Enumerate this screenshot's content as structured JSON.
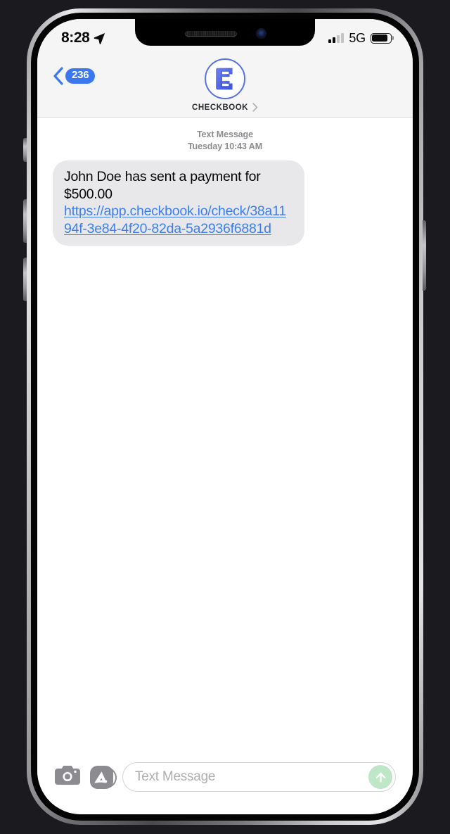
{
  "status_bar": {
    "time": "8:28",
    "location_icon": "location-arrow-icon",
    "signal_icon": "cellular-signal-icon",
    "signal_bars_filled": 2,
    "signal_bars_total": 4,
    "network": "5G",
    "battery_icon": "battery-icon",
    "battery_level_percent": 82
  },
  "header": {
    "back_icon": "chevron-left-icon",
    "unread_count": "236",
    "avatar_icon": "checkbook-logo-icon",
    "contact_name": "CHECKBOOK",
    "detail_icon": "chevron-right-icon"
  },
  "conversation": {
    "service_label": "Text Message",
    "timestamp": "Tuesday 10:43 AM",
    "messages": [
      {
        "sender": "incoming",
        "text": "John Doe has sent a payment for $500.00 ",
        "link": "https://app.checkbook.io/check/38a1194f-3e84-4f20-82da-5a2936f6881d"
      }
    ]
  },
  "input_bar": {
    "camera_icon": "camera-icon",
    "apps_icon": "app-store-icon",
    "placeholder": "Text Message",
    "value": "",
    "send_icon": "arrow-up-icon"
  },
  "colors": {
    "accent_blue": "#3b78f0",
    "link_blue": "#3b7ef0",
    "bubble_gray": "#e8e8ea",
    "send_green": "#bfe6c7",
    "header_bg": "#f5f5f6"
  }
}
